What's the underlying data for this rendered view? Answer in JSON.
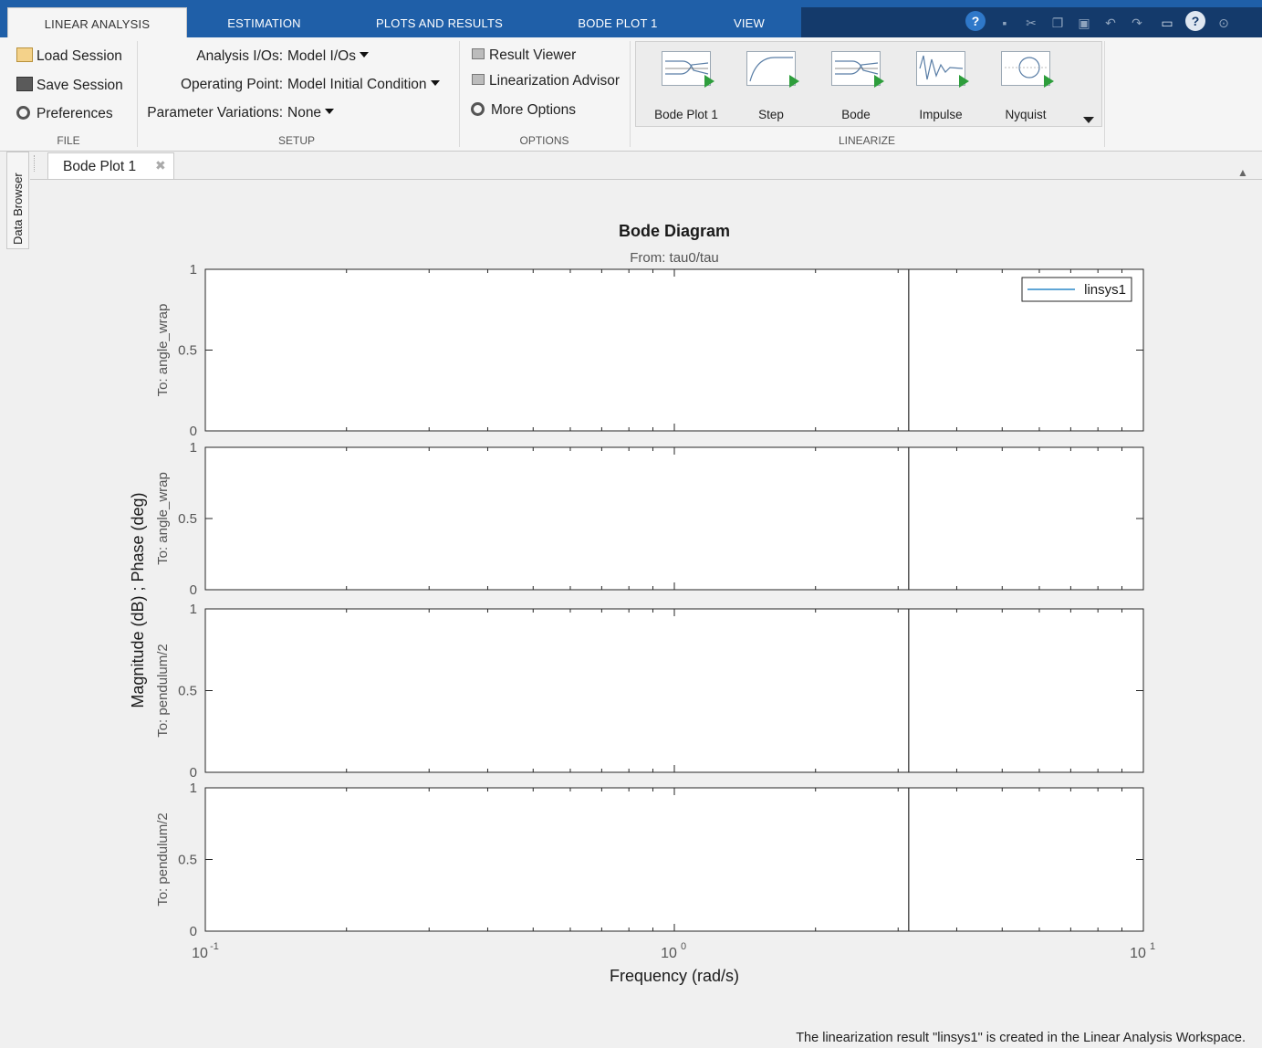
{
  "ribbon_tabs": [
    {
      "label": "LINEAR ANALYSIS",
      "active": true
    },
    {
      "label": "ESTIMATION",
      "active": false
    },
    {
      "label": "PLOTS AND RESULTS",
      "active": false
    },
    {
      "label": "BODE PLOT 1",
      "active": false
    },
    {
      "label": "VIEW",
      "active": false
    }
  ],
  "quick_access": [
    "help-circle-icon",
    "save-icon",
    "cut-icon",
    "copy-icon",
    "paste-icon",
    "undo-icon",
    "redo-icon",
    "window-icon",
    "help-icon",
    "expand-icon"
  ],
  "file_group": {
    "label": "FILE",
    "load_session": "Load Session",
    "save_session": "Save Session",
    "preferences": "Preferences"
  },
  "setup_group": {
    "label": "SETUP",
    "analysis_ios_label": "Analysis I/Os:",
    "analysis_ios_value": "Model I/Os",
    "operating_point_label": "Operating Point:",
    "operating_point_value": "Model Initial Condition",
    "parameter_variations_label": "Parameter Variations:",
    "parameter_variations_value": "None"
  },
  "options_group": {
    "label": "OPTIONS",
    "result_viewer": "Result Viewer",
    "linearization_advisor": "Linearization Advisor",
    "more_options": "More Options"
  },
  "linearize_group": {
    "label": "LINEARIZE",
    "items": [
      "Bode Plot 1",
      "Step",
      "Bode",
      "Impulse",
      "Nyquist"
    ]
  },
  "side_panel": {
    "data_browser": "Data Browser"
  },
  "document_tab": {
    "label": "Bode Plot 1"
  },
  "chart_data": {
    "type": "line",
    "title": "Bode Diagram",
    "subtitle": "From: tau0/tau",
    "xlabel": "Frequency  (rad/s)",
    "ylabel": "Magnitude (dB) ; Phase (deg)",
    "xscale": "log",
    "xlim": [
      0.1,
      10
    ],
    "xticks": [
      "10^-1",
      "10^0",
      "10^1"
    ],
    "vertical_line_x": 3.16,
    "legend": {
      "entries": [
        "linsys1"
      ],
      "placement": "top-right"
    },
    "series": [
      {
        "name": "linsys1",
        "color": "#0072bd",
        "values": []
      }
    ],
    "subplots": [
      {
        "label": "To: angle_wrap",
        "ylim": [
          0,
          1
        ],
        "yticks": [
          "0",
          "0.5",
          "1"
        ]
      },
      {
        "label": "To: angle_wrap",
        "ylim": [
          0,
          1
        ],
        "yticks": [
          "0",
          "0.5",
          "1"
        ]
      },
      {
        "label": "To: pendulum/2",
        "ylim": [
          0,
          1
        ],
        "yticks": [
          "0",
          "0.5",
          "1"
        ]
      },
      {
        "label": "To: pendulum/2",
        "ylim": [
          0,
          1
        ],
        "yticks": [
          "0",
          "0.5",
          "1"
        ]
      }
    ]
  },
  "status": "The linearization result \"linsys1\" is created in the Linear Analysis Workspace."
}
